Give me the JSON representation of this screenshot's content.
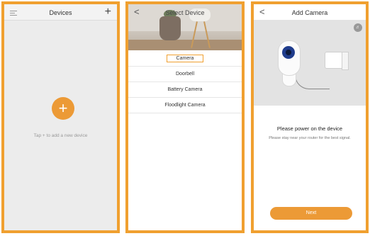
{
  "screen1": {
    "title": "Devices",
    "add_symbol": "+",
    "fab_symbol": "+",
    "hint": "Tap + to add a new device"
  },
  "screen2": {
    "title": "Select Device",
    "back_symbol": "<",
    "devices": [
      "Camera",
      "Doorbell",
      "Battery Camera",
      "Floodlight Camera"
    ],
    "selected": "Camera"
  },
  "screen3": {
    "title": "Add Camera",
    "back_symbol": "<",
    "heading": "Please power on the device",
    "subtext": "Please stay near your router for the best signal.",
    "next_label": "Next"
  },
  "colors": {
    "accent": "#ec9a36",
    "highlight_border": "#f0a030"
  }
}
